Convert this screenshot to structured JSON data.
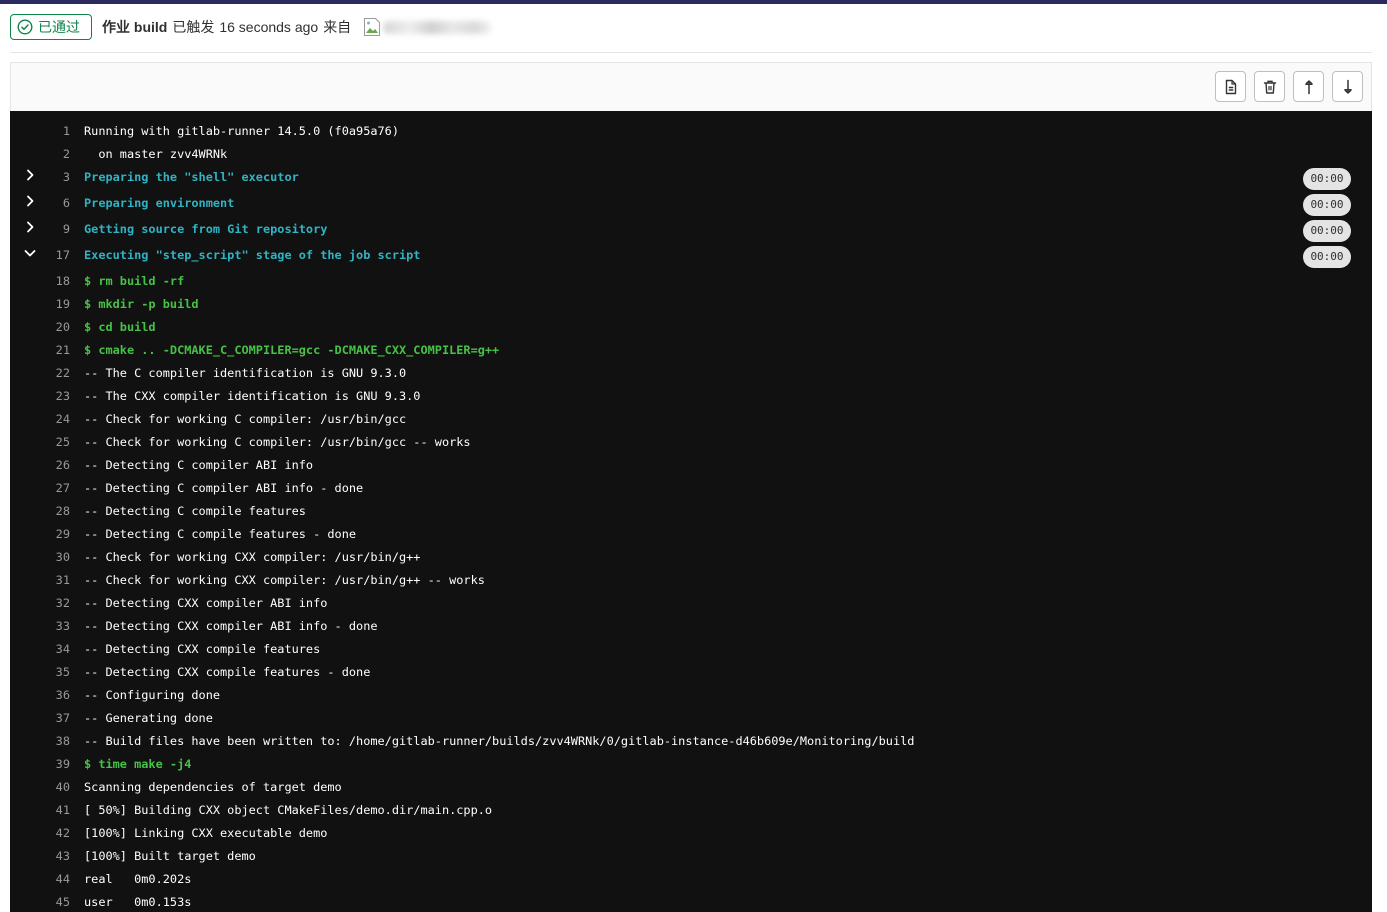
{
  "header": {
    "status": {
      "label": "已通过",
      "icon": "status-success-icon"
    },
    "job_label": "作业",
    "job_name": "build",
    "triggered_label": "已触发",
    "time_ago": "16 seconds ago",
    "by_label": "来自",
    "author": {
      "avatar_icon": "broken-image-icon"
    }
  },
  "toolbar": {
    "buttons": [
      {
        "icon": "doc-text-icon"
      },
      {
        "icon": "trash-icon"
      },
      {
        "icon": "scroll-up-icon"
      },
      {
        "icon": "scroll-down-icon"
      }
    ]
  },
  "log": {
    "lines": [
      {
        "number": 1,
        "text": "Running with gitlab-runner 14.5.0 (f0a95a76)"
      },
      {
        "number": 2,
        "text": "  on master zvv4WRNk"
      },
      {
        "number": 3,
        "text": "Preparing the \"shell\" executor",
        "duration": "00:00",
        "collapsed": true,
        "chevron_icon": "chevron-right-icon"
      },
      {
        "number": 6,
        "text": "Preparing environment",
        "duration": "00:00",
        "collapsed": true,
        "chevron_icon": "chevron-right-icon"
      },
      {
        "number": 9,
        "text": "Getting source from Git repository",
        "duration": "00:00",
        "collapsed": true,
        "chevron_icon": "chevron-right-icon"
      },
      {
        "number": 17,
        "text": "Executing \"step_script\" stage of the job script",
        "duration": "00:00",
        "collapsed": false,
        "chevron_icon": "chevron-down-icon"
      },
      {
        "number": 18,
        "text": "$ rm build -rf"
      },
      {
        "number": 19,
        "text": "$ mkdir -p build"
      },
      {
        "number": 20,
        "text": "$ cd build"
      },
      {
        "number": 21,
        "text": "$ cmake .. -DCMAKE_C_COMPILER=gcc -DCMAKE_CXX_COMPILER=g++"
      },
      {
        "number": 22,
        "text": "-- The C compiler identification is GNU 9.3.0"
      },
      {
        "number": 23,
        "text": "-- The CXX compiler identification is GNU 9.3.0"
      },
      {
        "number": 24,
        "text": "-- Check for working C compiler: /usr/bin/gcc"
      },
      {
        "number": 25,
        "text": "-- Check for working C compiler: /usr/bin/gcc -- works"
      },
      {
        "number": 26,
        "text": "-- Detecting C compiler ABI info"
      },
      {
        "number": 27,
        "text": "-- Detecting C compiler ABI info - done"
      },
      {
        "number": 28,
        "text": "-- Detecting C compile features"
      },
      {
        "number": 29,
        "text": "-- Detecting C compile features - done"
      },
      {
        "number": 30,
        "text": "-- Check for working CXX compiler: /usr/bin/g++"
      },
      {
        "number": 31,
        "text": "-- Check for working CXX compiler: /usr/bin/g++ -- works"
      },
      {
        "number": 32,
        "text": "-- Detecting CXX compiler ABI info"
      },
      {
        "number": 33,
        "text": "-- Detecting CXX compiler ABI info - done"
      },
      {
        "number": 34,
        "text": "-- Detecting CXX compile features"
      },
      {
        "number": 35,
        "text": "-- Detecting CXX compile features - done"
      },
      {
        "number": 36,
        "text": "-- Configuring done"
      },
      {
        "number": 37,
        "text": "-- Generating done"
      },
      {
        "number": 38,
        "text": "-- Build files have been written to: /home/gitlab-runner/builds/zvv4WRNk/0/gitlab-instance-d46b609e/Monitoring/build"
      },
      {
        "number": 39,
        "text": "$ time make -j4"
      },
      {
        "number": 40,
        "text": "Scanning dependencies of target demo"
      },
      {
        "number": 41,
        "text": "[ 50%] Building CXX object CMakeFiles/demo.dir/main.cpp.o"
      },
      {
        "number": 42,
        "text": "[100%] Linking CXX executable demo"
      },
      {
        "number": 43,
        "text": "[100%] Built target demo"
      },
      {
        "number": 44,
        "text": "real   0m0.202s"
      },
      {
        "number": 45,
        "text": "user   0m0.153s"
      }
    ]
  },
  "colors": {
    "top_bar": "#2b2a5e",
    "status_success": "#108548",
    "log_background": "#111111",
    "log_text": "#ffffff",
    "line_number": "#999999",
    "section_title": "#30b4c4",
    "command": "#47c247",
    "duration_badge_bg": "#e4e4e4"
  }
}
